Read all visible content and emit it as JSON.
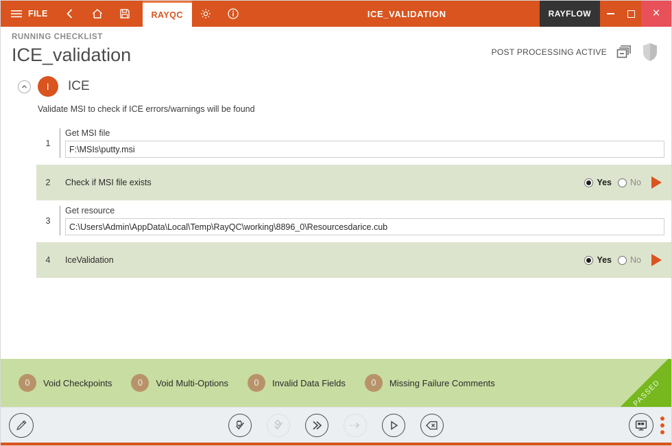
{
  "titlebar": {
    "menu_icon": "hamburger-icon",
    "file_label": "FILE",
    "back_icon": "chevron-left-icon",
    "home_icon": "home-icon",
    "save_icon": "save-disk-icon",
    "tab_label": "RAYQC",
    "settings_icon": "gear-icon",
    "info_icon": "info-icon",
    "document_title": "ICE_VALIDATION",
    "rayflow_label": "RAYFLOW",
    "minimize_label": "Minimize",
    "maximize_label": "Maximize",
    "close_label": "×"
  },
  "header": {
    "kicker": "RUNNING CHECKLIST",
    "title": "ICE_validation",
    "post_processing": "POST PROCESSING ACTIVE",
    "copy_icon": "copy-windows-icon",
    "shield_icon": "shield-icon"
  },
  "section": {
    "collapse_icon": "chevron-up-icon",
    "badge": "I",
    "name": "ICE",
    "description": "Validate MSI to check if ICE errors/warnings will be found"
  },
  "rows": [
    {
      "number": "1",
      "type": "input",
      "label": "Get MSI file",
      "value": "F:\\MSIs\\putty.msi",
      "placeholder": ""
    },
    {
      "number": "2",
      "type": "choice",
      "label": "Check if MSI file exists",
      "yes_label": "Yes",
      "no_label": "No",
      "selected": "Yes",
      "run_icon": "play-triangle-icon"
    },
    {
      "number": "3",
      "type": "input",
      "label": "Get resource",
      "value": "C:\\Users\\Admin\\AppData\\Local\\Temp\\RayQC\\working\\8896_0\\Resourcesdarice.cub",
      "placeholder": ""
    },
    {
      "number": "4",
      "type": "choice",
      "label": "IceValidation",
      "yes_label": "Yes",
      "no_label": "No",
      "selected": "Yes",
      "run_icon": "play-triangle-icon"
    }
  ],
  "statusbar": {
    "items": [
      {
        "count": "0",
        "label": "Void Checkpoints"
      },
      {
        "count": "0",
        "label": "Void Multi-Options"
      },
      {
        "count": "0",
        "label": "Invalid Data Fields"
      },
      {
        "count": "0",
        "label": "Missing Failure Comments"
      }
    ],
    "ribbon": "PASSED"
  },
  "toolbar": {
    "edit_icon": "pencil-edit-icon",
    "center_buttons": [
      {
        "icon": "plug-check-icon",
        "enabled": true
      },
      {
        "icon": "diamond-check-icon",
        "enabled": false
      },
      {
        "icon": "double-chevron-right-icon",
        "enabled": true
      },
      {
        "icon": "dotted-arrow-right-icon",
        "enabled": false
      },
      {
        "icon": "play-icon",
        "enabled": true
      },
      {
        "icon": "backspace-delete-icon",
        "enabled": true
      }
    ],
    "monitor_icon": "monitor-windows-icon",
    "more_icon": "more-vertical-dots-icon"
  },
  "colors": {
    "brand_orange": "#d9541e",
    "row_green": "#dde4cd",
    "status_green": "#c8dda1",
    "ribbon_green": "#76b81e",
    "badge_tan": "#b8936a",
    "rayflow_dark": "#343434",
    "close_red": "#e8505a"
  }
}
